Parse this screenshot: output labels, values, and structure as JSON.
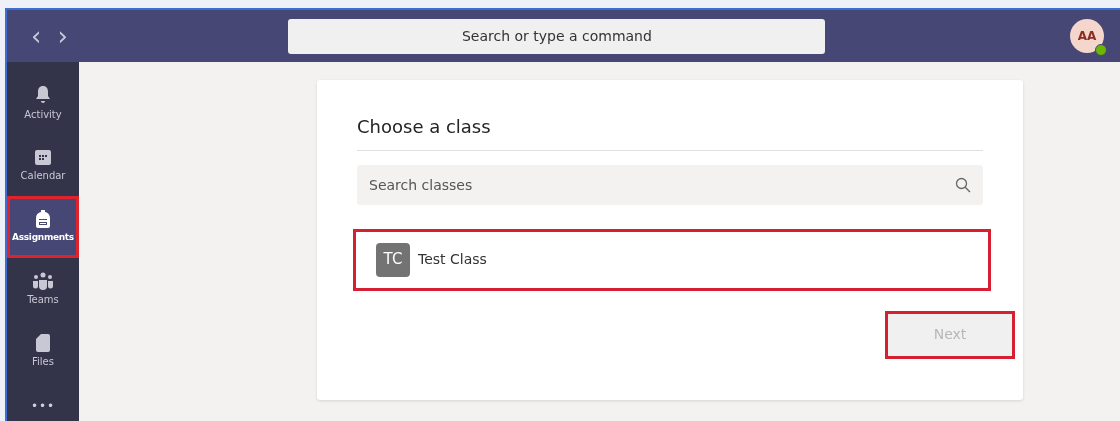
{
  "top_bar": {
    "back": "‹",
    "forward": "›",
    "search": {
      "placeholder": "Search or type a command"
    },
    "avatar": {
      "initials": "AA",
      "online": true
    }
  },
  "sidebar": {
    "items": [
      {
        "label": "Activity",
        "kind": "bell",
        "selected": false,
        "highlighted": false
      },
      {
        "label": "Calendar",
        "kind": "calendar",
        "selected": false,
        "highlighted": false
      },
      {
        "label": "Assignments",
        "kind": "backpack",
        "selected": true,
        "highlighted": true
      },
      {
        "label": "Teams",
        "kind": "people",
        "selected": false,
        "highlighted": false
      },
      {
        "label": "Files",
        "kind": "file",
        "selected": false,
        "highlighted": false
      }
    ],
    "more": "•••"
  },
  "dialog": {
    "title": "Choose a class",
    "search": {
      "placeholder": "Search classes"
    },
    "classes": [
      {
        "initials": "TC",
        "name": "Test Class",
        "highlighted": true
      }
    ],
    "next_button": {
      "label": "Next",
      "disabled": true,
      "highlighted": true
    }
  }
}
